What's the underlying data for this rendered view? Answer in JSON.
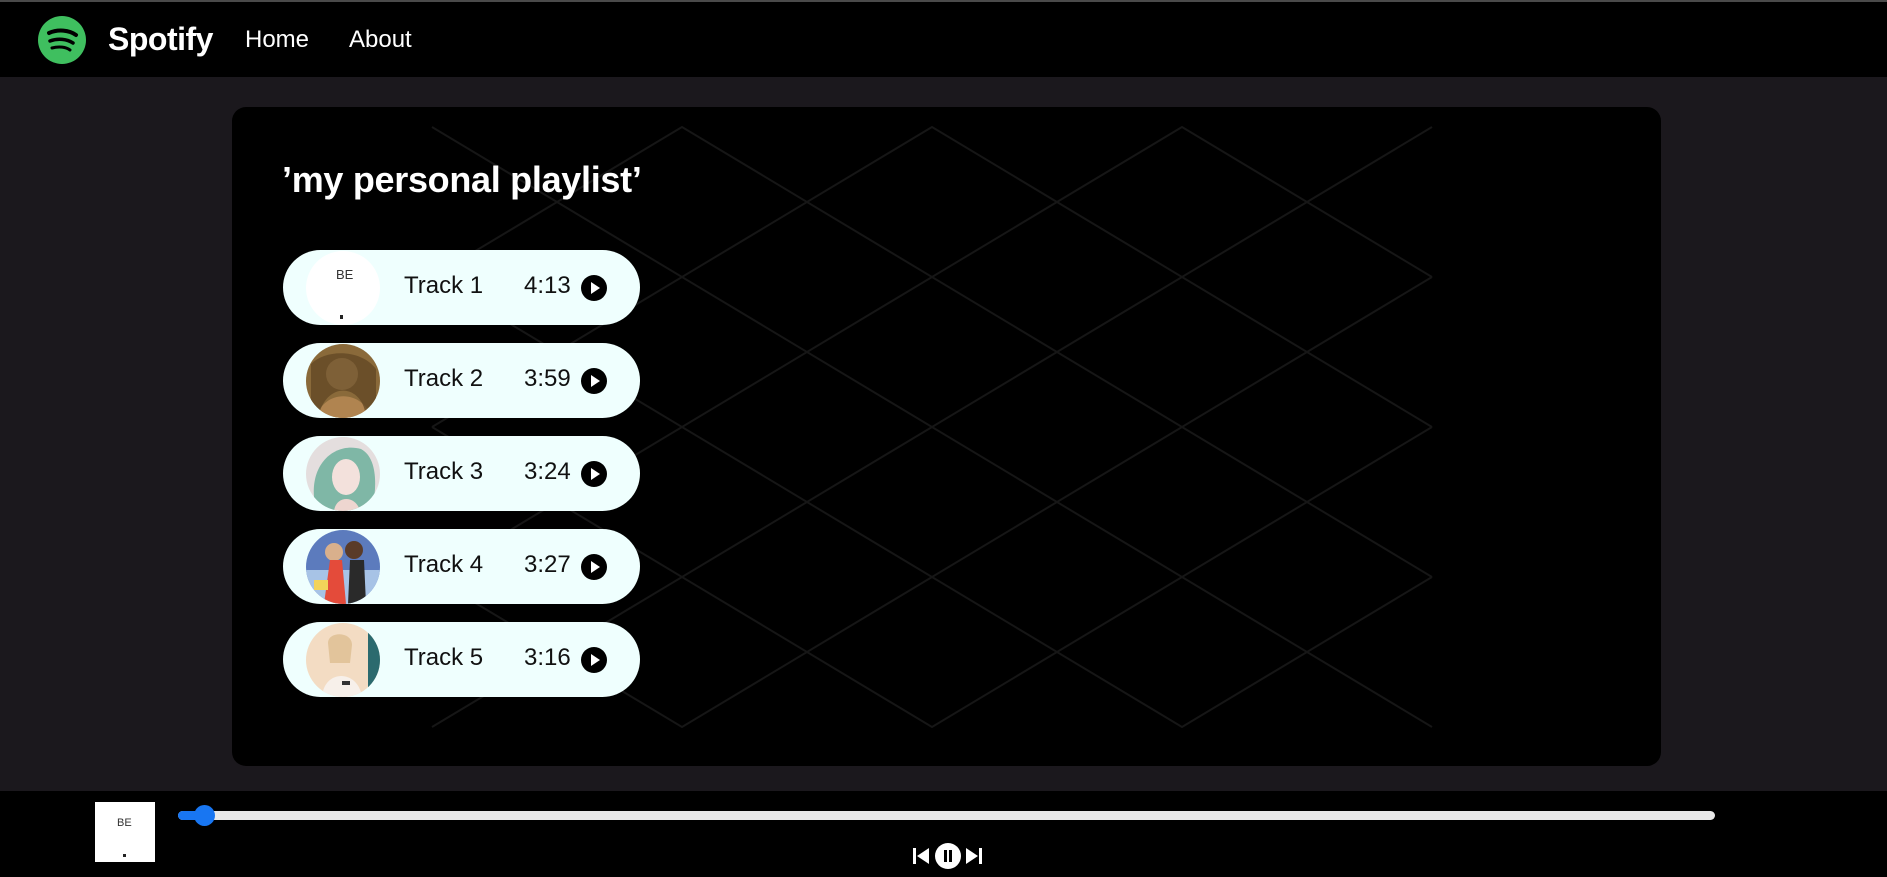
{
  "navbar": {
    "brand": "Spotify",
    "links": [
      "Home",
      "About"
    ],
    "logo_icon": "spotify-logo-icon",
    "logo_color": "#3fbf5f"
  },
  "playlist": {
    "title": "’my personal playlist’",
    "tracks": [
      {
        "name": "Track 1",
        "duration": "4:13",
        "art_icon": "album-art-be",
        "play_icon": "play-icon"
      },
      {
        "name": "Track 2",
        "duration": "3:59",
        "art_icon": "album-art-portrait",
        "play_icon": "play-icon"
      },
      {
        "name": "Track 3",
        "duration": "3:24",
        "art_icon": "album-art-portrait",
        "play_icon": "play-icon"
      },
      {
        "name": "Track 4",
        "duration": "3:27",
        "art_icon": "album-art-portrait",
        "play_icon": "play-icon"
      },
      {
        "name": "Track 5",
        "duration": "3:16",
        "art_icon": "album-art-portrait",
        "play_icon": "play-icon"
      }
    ]
  },
  "player": {
    "now_playing_art": "album-art-be",
    "progress_fraction": 0.017,
    "progress_color": "#1876f2",
    "controls": [
      "previous-icon",
      "pause-icon",
      "next-icon"
    ]
  },
  "colors": {
    "page_background": "#1b181d",
    "panel_background": "#000000",
    "track_background": "#effffe"
  }
}
